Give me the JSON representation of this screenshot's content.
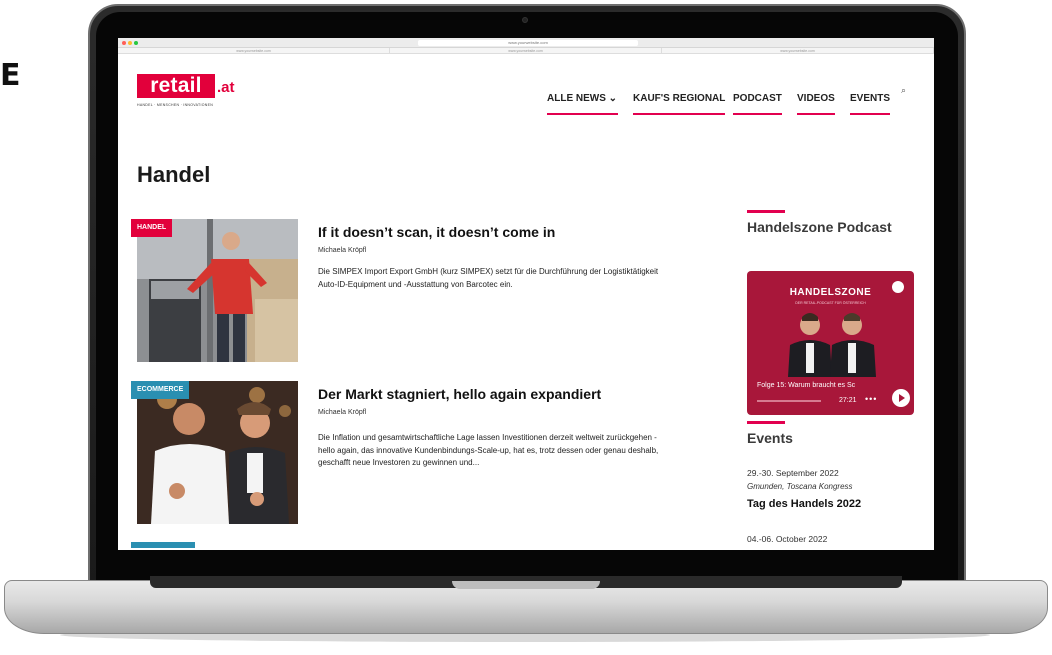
{
  "edge_glyph": "E",
  "browser": {
    "url": "www.yourwebsite.com",
    "tabs": [
      "www.yourwebsite.com",
      "www.yourwebsite.com",
      "www.yourwebsite.com"
    ]
  },
  "site": {
    "logo": {
      "name": "retail",
      "tld": ".at",
      "tagline": "HANDEL · MENSCHEN · INNOVATIONEN"
    },
    "nav": [
      {
        "label": "ALLE NEWS ⌄"
      },
      {
        "label": "KAUF'S REGIONAL"
      },
      {
        "label": "PODCAST"
      },
      {
        "label": "VIDEOS"
      },
      {
        "label": "EVENTS"
      }
    ],
    "search_icon": "⌕",
    "accent_color": "#e2004f",
    "page_title": "Handel",
    "articles": [
      {
        "category": "HANDEL",
        "category_color": "#e2003b",
        "title": "If it doesn’t scan, it doesn’t come in",
        "author": "Michaela Kröpfl",
        "excerpt": "Die SIMPEX Import Export GmbH (kurz SIMPEX) setzt für die Durchführung der Logistiktätigkeit Auto-ID-Equipment und -Ausstattung von Barcotec ein."
      },
      {
        "category": "ECOMMERCE",
        "category_color": "#2a8fb1",
        "title": "Der Markt stagniert, hello again expandiert",
        "author": "Michaela Kröpfl",
        "excerpt": "Die Inflation und gesamtwirtschaftliche Lage lassen Investitionen derzeit weltweit zurückgehen - hello again, das innovative Kundenbindungs-Scale-up, hat es, trotz dessen oder genau deshalb, geschafft neue Investoren zu gewinnen und..."
      }
    ],
    "sidebar": {
      "podcast_heading": "Handelszone Podcast",
      "podcast_card": {
        "title": "HANDELSZONE",
        "subtitle": "DER RETAIL-PODCAST FÜR ÖSTERREICH",
        "episode": "Folge 15: Warum braucht es Sc",
        "time": "27:21",
        "more": "•••",
        "progress": 0.0
      },
      "events_heading": "Events",
      "events": [
        {
          "date": "29.-30. September 2022",
          "place": "Gmunden, Toscana Kongress",
          "name": "Tag des Handels 2022"
        },
        {
          "date": "04.-06. October 2022"
        }
      ]
    }
  }
}
